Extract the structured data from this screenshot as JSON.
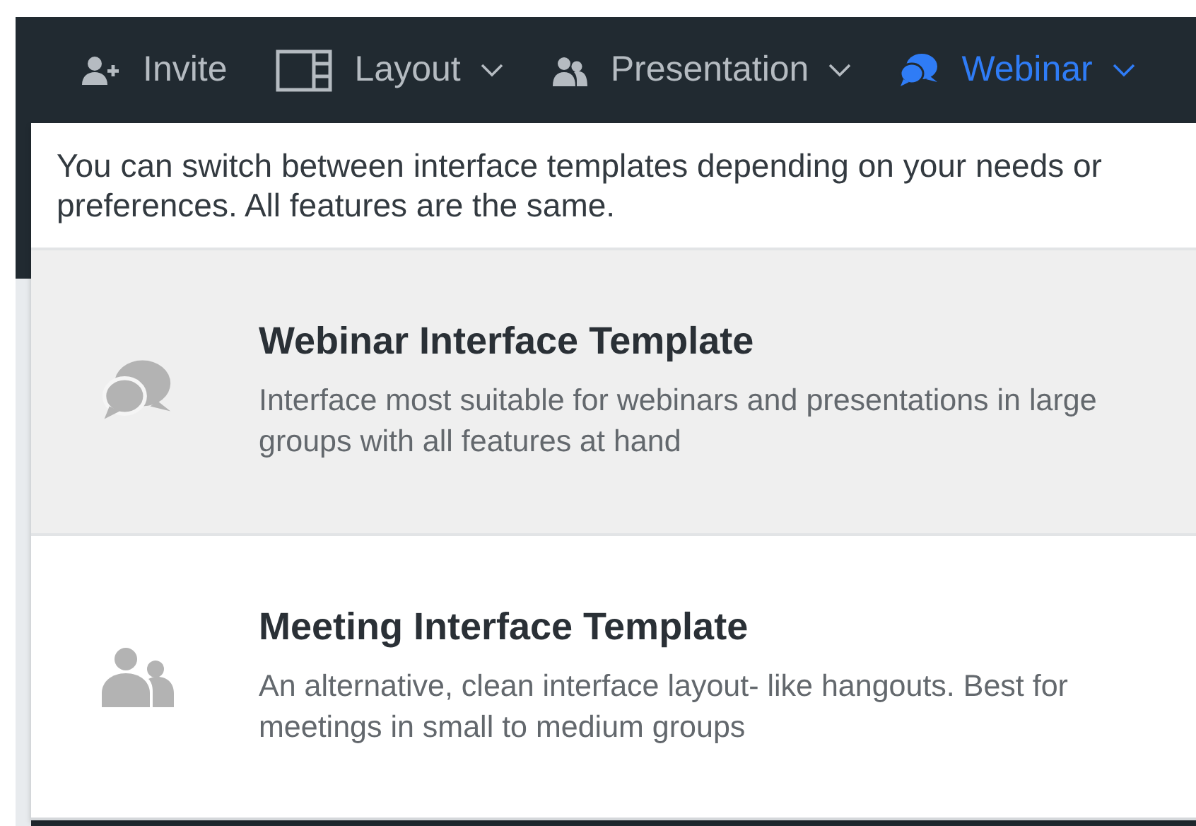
{
  "toolbar": {
    "items": [
      {
        "label": "Invite",
        "kind": "invite",
        "dropdown": false,
        "selected": false
      },
      {
        "label": "Layout",
        "kind": "layout",
        "dropdown": true,
        "selected": false
      },
      {
        "label": "Presentation",
        "kind": "presentation",
        "dropdown": true,
        "selected": false
      },
      {
        "label": "Webinar",
        "kind": "webinar",
        "dropdown": true,
        "selected": true
      }
    ]
  },
  "menu": {
    "intro": "You can switch between interface templates depending on your needs or preferences. All features are the same.",
    "templates": [
      {
        "kind": "webinar",
        "title": "Webinar Interface Template",
        "description": "Interface most suitable for webinars and presentations in large groups with all features at hand",
        "selected": true
      },
      {
        "kind": "meeting",
        "title": "Meeting Interface Template",
        "description": "An alternative, clean interface layout- like hangouts. Best for meetings in small to medium groups",
        "selected": false
      }
    ]
  }
}
